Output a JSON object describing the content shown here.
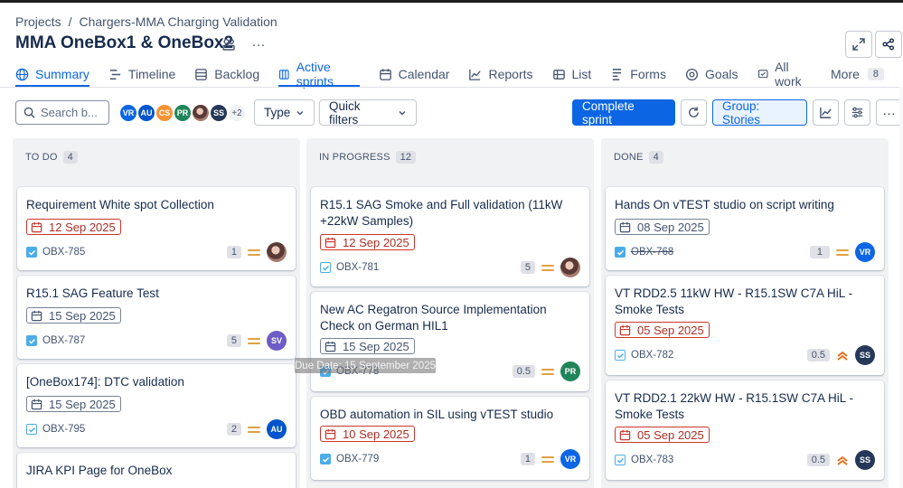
{
  "breadcrumb": {
    "projects": "Projects",
    "separator": "/",
    "project": "Chargers-MMA Charging Validation"
  },
  "page_title": "MMA OneBox1 & OneBox2",
  "tabs": [
    {
      "label": "Summary",
      "icon": "globe-icon",
      "active": true
    },
    {
      "label": "Timeline",
      "icon": "timeline-icon"
    },
    {
      "label": "Backlog",
      "icon": "backlog-icon"
    },
    {
      "label": "Active sprints",
      "icon": "board-icon"
    },
    {
      "label": "Calendar",
      "icon": "calendar-icon"
    },
    {
      "label": "Reports",
      "icon": "reports-icon"
    },
    {
      "label": "List",
      "icon": "list-icon"
    },
    {
      "label": "Forms",
      "icon": "forms-icon"
    },
    {
      "label": "Goals",
      "icon": "goals-icon"
    },
    {
      "label": "All work",
      "icon": "all-work-icon"
    },
    {
      "label": "More",
      "count": "8"
    }
  ],
  "toolbar": {
    "search_placeholder": "Search b...",
    "avatars": [
      {
        "initials": "VR",
        "color": "#0c66e4"
      },
      {
        "initials": "AU",
        "color": "#0055cc"
      },
      {
        "initials": "CS",
        "color": "#f79232"
      },
      {
        "initials": "PR",
        "color": "#1f845a"
      },
      {
        "initials": "",
        "photo": true
      },
      {
        "initials": "SS",
        "color": "#253858"
      }
    ],
    "avatars_more": "+2",
    "type_label": "Type",
    "quick_filters_label": "Quick filters",
    "complete_sprint_label": "Complete sprint",
    "group_label": "Group: Stories"
  },
  "columns": [
    {
      "name": "TO DO",
      "count": "4",
      "cards": [
        {
          "title": "Requirement White spot Collection",
          "date": "12 Sep 2025",
          "overdue": true,
          "key": "OBX-785",
          "estimate": "1",
          "assignee": "photo"
        },
        {
          "title": "R15.1 SAG Feature Test",
          "date": "15 Sep 2025",
          "overdue": false,
          "key": "OBX-787",
          "estimate": "5",
          "assignee": "SV"
        },
        {
          "title": "[OneBox174]: DTC validation",
          "date": "15 Sep 2025",
          "overdue": false,
          "key": "OBX-795",
          "estimate": "2",
          "assignee": "AU"
        },
        {
          "title": "JIRA KPI Page for OneBox"
        }
      ]
    },
    {
      "name": "IN PROGRESS",
      "count": "12",
      "cards": [
        {
          "title": "R15.1 SAG Smoke and Full validation (11kW +22kW Samples)",
          "date": "12 Sep 2025",
          "overdue": true,
          "key": "OBX-781",
          "estimate": "5",
          "assignee": "photo"
        },
        {
          "title": "New AC Regatron Source Implementation Check on German HIL1",
          "date": "15 Sep 2025",
          "overdue": false,
          "key": "OBX-778",
          "estimate": "0.5",
          "assignee": "PR"
        },
        {
          "title": "OBD automation in SIL using vTEST studio",
          "date": "10 Sep 2025",
          "overdue": true,
          "key": "OBX-779",
          "estimate": "1",
          "assignee": "VR"
        }
      ]
    },
    {
      "name": "DONE",
      "count": "4",
      "cards": [
        {
          "title": "Hands On vTEST studio on script writing",
          "date": "08 Sep 2025",
          "overdue": false,
          "key": "OBX-768",
          "estimate": "1",
          "assignee": "VR"
        },
        {
          "title": "VT RDD2.5 11kW HW - R15.1SW C7A HiL - Smoke Tests",
          "date": "05 Sep 2025",
          "overdue": true,
          "key": "OBX-782",
          "estimate": "0.5",
          "assignee": "SS"
        },
        {
          "title": "VT RDD2.1 22kW HW - R15.1SW C7A HiL - Smoke Tests",
          "date": "05 Sep 2025",
          "overdue": true,
          "key": "OBX-783",
          "estimate": "0.5",
          "assignee": "SS"
        }
      ]
    }
  ],
  "tooltip": "Due Date: 15 September 2025",
  "colors": {
    "accent": "#0c66e4",
    "overdue": "#c9372c",
    "medium_priority": "#e2a03f",
    "high_priority": "#e56910"
  }
}
